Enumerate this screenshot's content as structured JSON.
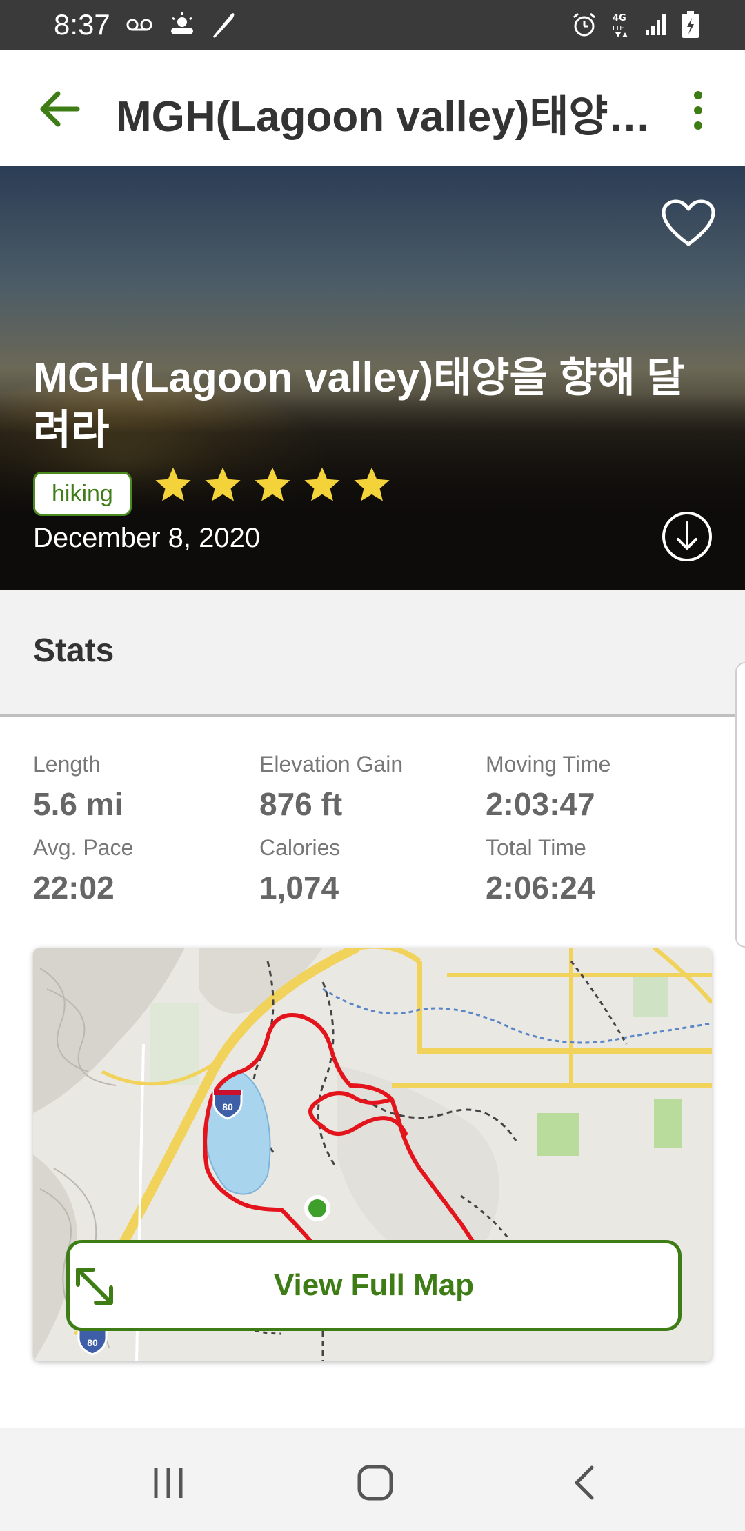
{
  "status_bar": {
    "time": "8:37",
    "left_icons": [
      "voicemail-icon",
      "weather-icon",
      "feather-icon"
    ],
    "right_icons": [
      "alarm-icon",
      "4g-lte-icon",
      "signal-icon",
      "battery-charging-icon"
    ]
  },
  "app_bar": {
    "title": "MGH(Lagoon valley)태양을 향해 달려라",
    "back_icon": "arrow-left-icon",
    "menu_icon": "more-vert-icon"
  },
  "hero": {
    "title": "MGH(Lagoon valley)태양을 향해 달려라",
    "activity_tag": "hiking",
    "rating": 5,
    "rating_max": 5,
    "date": "December 8, 2020",
    "favorite_icon": "heart-outline-icon",
    "download_icon": "download-circle-icon"
  },
  "stats": {
    "header": "Stats",
    "items": [
      {
        "label": "Length",
        "value": "5.6 mi"
      },
      {
        "label": "Elevation Gain",
        "value": "876 ft"
      },
      {
        "label": "Moving Time",
        "value": "2:03:47"
      },
      {
        "label": "Avg. Pace",
        "value": "22:02"
      },
      {
        "label": "Calories",
        "value": "1,074"
      },
      {
        "label": "Total Time",
        "value": "2:06:24"
      }
    ]
  },
  "map": {
    "highway_shield": "80",
    "view_full_map_label": "View Full Map",
    "expand_icon": "expand-arrows-icon",
    "route_color": "#e3141b",
    "start_marker_color": "#3ea02a"
  },
  "nav_bar": {
    "icons": [
      "recent-apps-icon",
      "home-icon",
      "back-icon"
    ]
  },
  "colors": {
    "accent": "#3e7d15",
    "star": "#f4d23a"
  }
}
